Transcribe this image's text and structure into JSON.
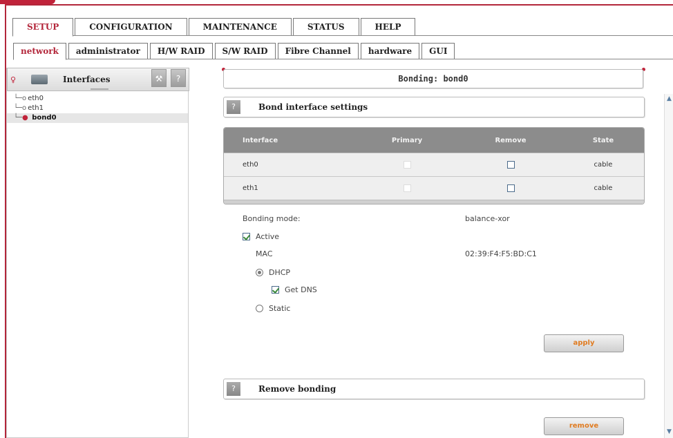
{
  "main_tabs": [
    {
      "label": "SETUP",
      "active": true
    },
    {
      "label": "CONFIGURATION",
      "active": false
    },
    {
      "label": "MAINTENANCE",
      "active": false
    },
    {
      "label": "STATUS",
      "active": false
    },
    {
      "label": "HELP",
      "active": false
    }
  ],
  "sub_tabs": [
    {
      "label": "network",
      "active": true
    },
    {
      "label": "administrator",
      "active": false
    },
    {
      "label": "H/W RAID",
      "active": false
    },
    {
      "label": "S/W RAID",
      "active": false
    },
    {
      "label": "Fibre Channel",
      "active": false
    },
    {
      "label": "hardware",
      "active": false
    },
    {
      "label": "GUI",
      "active": false
    }
  ],
  "left_panel": {
    "title": "Interfaces",
    "wrench_icon": "wrench-icon",
    "help_label": "?",
    "tree": [
      {
        "label": "eth0",
        "selected": false
      },
      {
        "label": "eth1",
        "selected": false
      },
      {
        "label": "bond0",
        "selected": true
      }
    ]
  },
  "main": {
    "page_title": "Bonding: bond0",
    "bond_section": {
      "help_label": "?",
      "title": "Bond interface settings",
      "table": {
        "headers": [
          "Interface",
          "Primary",
          "Remove",
          "State"
        ],
        "rows": [
          {
            "interface": "eth0",
            "primary": false,
            "remove": false,
            "state": "cable"
          },
          {
            "interface": "eth1",
            "primary": false,
            "remove": false,
            "state": "cable"
          }
        ]
      },
      "bonding_mode_label": "Bonding mode:",
      "bonding_mode_value": "balance-xor",
      "active_label": "Active",
      "active_checked": true,
      "mac_label": "MAC",
      "mac_value": "02:39:F4:F5:BD:C1",
      "dhcp_label": "DHCP",
      "dhcp_selected": true,
      "get_dns_label": "Get DNS",
      "get_dns_checked": true,
      "static_label": "Static",
      "static_selected": false,
      "apply_label": "apply"
    },
    "remove_section": {
      "help_label": "?",
      "title": "Remove bonding",
      "remove_label": "remove"
    }
  },
  "colors": {
    "accent_red": "#b3263a",
    "button_text_orange": "#e07b20",
    "table_header_gray": "#8c8c8c"
  }
}
